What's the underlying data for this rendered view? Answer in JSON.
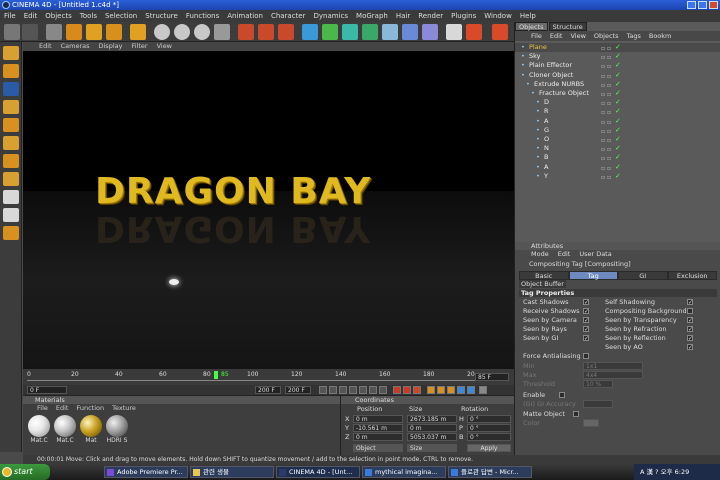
{
  "window": {
    "title": "CINEMA 4D - [Untitled 1.c4d *]"
  },
  "menubar": [
    "File",
    "Edit",
    "Objects",
    "Tools",
    "Selection",
    "Structure",
    "Functions",
    "Animation",
    "Character",
    "Dynamics",
    "MoGraph",
    "Hair",
    "Render",
    "Plugins",
    "Window",
    "Help"
  ],
  "viewport": {
    "menu": [
      "Edit",
      "Cameras",
      "Display",
      "Filter",
      "View"
    ],
    "scene_text": "DRAGON BAY"
  },
  "timeline": {
    "ticks": [
      "0",
      "20",
      "40",
      "60",
      "80",
      "100",
      "120",
      "140",
      "160",
      "180",
      "20"
    ],
    "current_frame": "85",
    "end_frame_label": "85 F",
    "start_field": "0 F",
    "field_a": "200 F",
    "field_b": "200 F"
  },
  "materials": {
    "header": "Materials",
    "menu": [
      "File",
      "Edit",
      "Function",
      "Texture"
    ],
    "items": [
      {
        "label": "Mat.C",
        "color": "#e8e8e8"
      },
      {
        "label": "Mat.C",
        "color": "#c8c8c8"
      },
      {
        "label": "Mat",
        "color": "#c8a020"
      },
      {
        "label": "HDRI S",
        "color": "#a0a0a0"
      }
    ]
  },
  "coordinates": {
    "header": "Coordinates",
    "columns": [
      "Position",
      "Size",
      "Rotation"
    ],
    "rows": [
      {
        "axis": "X",
        "pos": "0 m",
        "size": "2673.185 m",
        "rot_axis": "H",
        "rot": "0 °"
      },
      {
        "axis": "Y",
        "pos": "-10.561 m",
        "size": "0 m",
        "rot_axis": "P",
        "rot": "0 °"
      },
      {
        "axis": "Z",
        "pos": "0 m",
        "size": "5053.037 m",
        "rot_axis": "B",
        "rot": "0 °"
      }
    ],
    "mode_left": "Object",
    "mode_right": "Size",
    "apply_label": "Apply"
  },
  "status": "00:00:01   Move: Click and drag to move elements. Hold down SHIFT to quantize movement / add to the selection in point mode, CTRL to remove.",
  "objects": {
    "tabs": [
      "Objects",
      "Structure"
    ],
    "menu": [
      "File",
      "Edit",
      "View",
      "Objects",
      "Tags",
      "Bookm"
    ],
    "items": [
      {
        "name": "Plane",
        "indent": 0,
        "highlight": true
      },
      {
        "name": "Sky",
        "indent": 0,
        "highlight": false
      },
      {
        "name": "Plain Effector",
        "indent": 0,
        "highlight": false
      },
      {
        "name": "Cloner Object",
        "indent": 0,
        "highlight": false
      },
      {
        "name": "Extrude NURBS",
        "indent": 1,
        "highlight": false
      },
      {
        "name": "Fracture Object",
        "indent": 2,
        "highlight": false
      },
      {
        "name": "D",
        "indent": 3,
        "highlight": false
      },
      {
        "name": "R",
        "indent": 3,
        "highlight": false
      },
      {
        "name": "A",
        "indent": 3,
        "highlight": false
      },
      {
        "name": "G",
        "indent": 3,
        "highlight": false
      },
      {
        "name": "O",
        "indent": 3,
        "highlight": false
      },
      {
        "name": "N",
        "indent": 3,
        "highlight": false
      },
      {
        "name": "B",
        "indent": 3,
        "highlight": false
      },
      {
        "name": "A",
        "indent": 3,
        "highlight": false
      },
      {
        "name": "Y",
        "indent": 3,
        "highlight": false
      }
    ]
  },
  "attributes": {
    "header": "Attributes",
    "menu": [
      "Mode",
      "Edit",
      "User Data"
    ],
    "title": "Compositing Tag [Compositing]",
    "tabs": [
      "Basic",
      "Tag",
      "GI",
      "Exclusion"
    ],
    "active_tab": "Tag",
    "object_buffer": "Object Buffer",
    "section": "Tag Properties",
    "left_props": [
      "Cast Shadows",
      "Receive Shadows",
      "Seen by Camera",
      "Seen by Rays",
      "Seen by GI"
    ],
    "right_props": [
      "Self Shadowing",
      "Compositing Background",
      "Seen by Transparency",
      "Seen by Refraction",
      "Seen by Reflection",
      "Seen by AO"
    ],
    "force_aa": "Force Antialiasing",
    "min_label": "Min",
    "min_value": "1x1",
    "max_label": "Max",
    "max_value": "4x4",
    "threshold_label": "Threshold",
    "threshold_value": "10 %",
    "enable_label": "Enable",
    "gi_accuracy_label": "(GI) GI Accuracy",
    "gi_accuracy_value": "",
    "matte_label": "Matte Object",
    "color_label": "Color"
  },
  "taskbar": {
    "start": "start",
    "tasks": [
      "Adobe Premiere Pr...",
      "관련 생물",
      "CINEMA 4D - [Unt...",
      "mythical imagina...",
      "플로관 답변 - Micr..."
    ],
    "active_task": 2,
    "tray_text": "A 漢 ? 오후 6:29"
  }
}
